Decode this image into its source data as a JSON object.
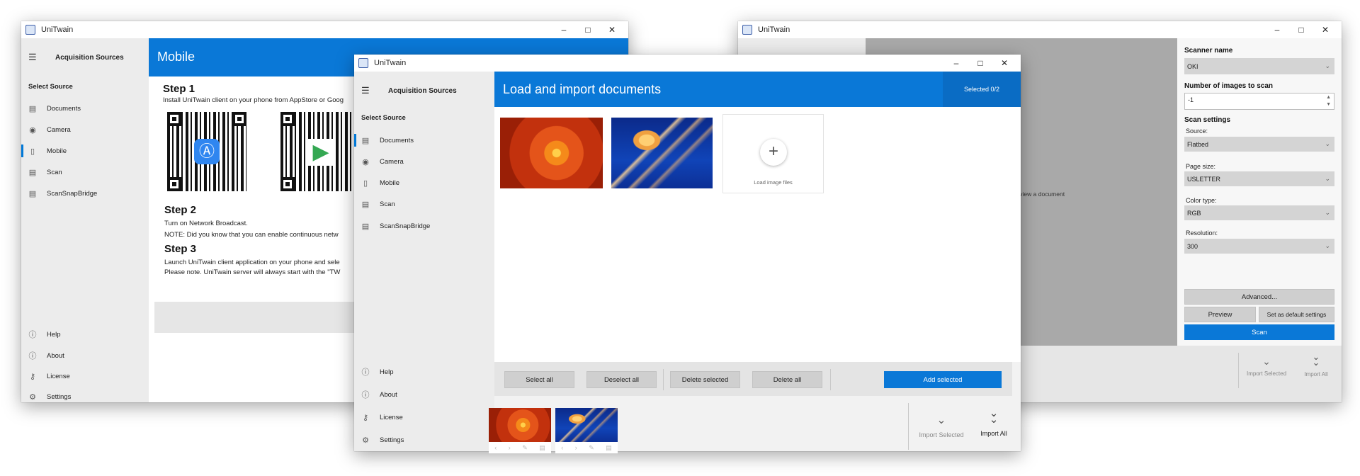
{
  "app": {
    "title": "UniTwain"
  },
  "nav": {
    "menu_title": "Acquisition Sources",
    "section": "Select Source",
    "items": [
      {
        "label": "Documents",
        "icon": "document-icon"
      },
      {
        "label": "Camera",
        "icon": "camera-icon"
      },
      {
        "label": "Mobile",
        "icon": "phone-icon"
      },
      {
        "label": "Scan",
        "icon": "scanner-icon"
      },
      {
        "label": "ScanSnapBridge",
        "icon": "scanner-icon"
      }
    ],
    "bottom": [
      {
        "label": "Help",
        "icon": "help-icon"
      },
      {
        "label": "About",
        "icon": "info-icon"
      },
      {
        "label": "License",
        "icon": "key-icon"
      },
      {
        "label": "Settings",
        "icon": "gear-icon"
      }
    ]
  },
  "mobile": {
    "header": "Mobile",
    "step1_title": "Step 1",
    "step1_text": "Install UniTwain client on your phone from AppStore or Goog",
    "step2_title": "Step 2",
    "step2_text1": "Turn on Network Broadcast.",
    "step2_text2": "NOTE: Did you know that you can enable continuous netw",
    "step3_title": "Step 3",
    "step3_text1": "Launch UniTwain client application on your phone and sele",
    "step3_text2": "Please note. UniTwain server will always start with the \"TW"
  },
  "load": {
    "header": "Load and import documents",
    "selected": "Selected 0/2",
    "load_files": "Load image files",
    "select_all": "Select all",
    "deselect_all": "Deselect all",
    "delete_selected": "Delete selected",
    "delete_all": "Delete all",
    "add_selected": "Add selected",
    "import_selected": "Import Selected",
    "import_all": "Import All"
  },
  "scan": {
    "preview_hint": "preview a document",
    "scanner_name_label": "Scanner name",
    "scanner_name_value": "OKI",
    "num_images_label": "Number of images to scan",
    "num_images_value": "-1",
    "settings_label": "Scan settings",
    "source_label": "Source:",
    "source_value": "Flatbed",
    "page_size_label": "Page size:",
    "page_size_value": "USLETTER",
    "color_type_label": "Color type:",
    "color_type_value": "RGB",
    "resolution_label": "Resolution:",
    "resolution_value": "300",
    "advanced": "Advanced...",
    "preview": "Preview",
    "set_default": "Set as default settings",
    "scan": "Scan",
    "import_selected": "Import Selected",
    "import_all": "Import All"
  },
  "colors": {
    "accent": "#0a78d7",
    "sidebar": "#ececec",
    "button": "#cfcfcf"
  }
}
